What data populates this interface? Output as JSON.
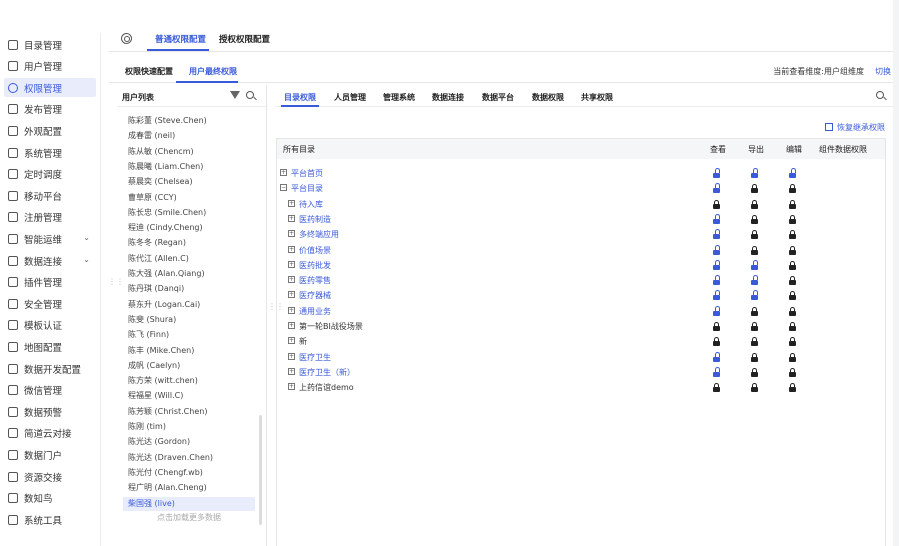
{
  "sidebar": {
    "items": [
      {
        "label": "目录管理",
        "icon": "list-icon"
      },
      {
        "label": "用户管理",
        "icon": "user-icon"
      },
      {
        "label": "权限管理",
        "icon": "shield-icon",
        "active": true
      },
      {
        "label": "发布管理",
        "icon": "publish-icon"
      },
      {
        "label": "外观配置",
        "icon": "palette-icon"
      },
      {
        "label": "系统管理",
        "icon": "gear-icon"
      },
      {
        "label": "定时调度",
        "icon": "clock-icon"
      },
      {
        "label": "移动平台",
        "icon": "mobile-icon"
      },
      {
        "label": "注册管理",
        "icon": "register-icon"
      },
      {
        "label": "智能运维",
        "icon": "ops-icon",
        "chevron": true
      },
      {
        "label": "数据连接",
        "icon": "link-icon",
        "chevron": true
      },
      {
        "label": "插件管理",
        "icon": "plugin-icon"
      },
      {
        "label": "安全管理",
        "icon": "security-icon"
      },
      {
        "label": "模板认证",
        "icon": "template-icon"
      },
      {
        "label": "地图配置",
        "icon": "map-icon"
      },
      {
        "label": "数据开发配置",
        "icon": "dev-icon"
      },
      {
        "label": "微信管理",
        "icon": "wechat-icon"
      },
      {
        "label": "数据预警",
        "icon": "alert-icon"
      },
      {
        "label": "简道云对接",
        "icon": "cloud-icon"
      },
      {
        "label": "数据门户",
        "icon": "portal-icon"
      },
      {
        "label": "资源交接",
        "icon": "handover-icon"
      },
      {
        "label": "数知鸟",
        "icon": "bird-icon"
      },
      {
        "label": "系统工具",
        "icon": "tools-icon"
      }
    ]
  },
  "top_tabs": [
    {
      "label": "普通权限配置",
      "active": true
    },
    {
      "label": "授权权限配置",
      "active": false
    }
  ],
  "sub_tabs": [
    {
      "label": "权限快速配置",
      "active": false
    },
    {
      "label": "用户最终权限",
      "active": true
    }
  ],
  "dimension_text": "当前查看维度:用户组维度",
  "switch_label": "切换",
  "user_list": {
    "title": "用户列表",
    "users": [
      "陈彩董 (Steve.Chen)",
      "成春雷 (neil)",
      "陈从敏 (Chencm)",
      "陈晨曦 (Liam.Chen)",
      "蔡晨奕 (Chelsea)",
      "曹草原 (CCY)",
      "陈长忠 (Smile.Chen)",
      "程迪 (Cindy.Cheng)",
      "陈冬冬 (Regan)",
      "陈代江 (Allen.C)",
      "陈大强 (Alan.Qiang)",
      "陈丹琪 (Danqi)",
      "蔡东升 (Logan.Cai)",
      "陈斐 (Shura)",
      "陈飞 (Finn)",
      "陈丰 (Mike.Chen)",
      "成帆 (Caelyn)",
      "陈方荣 (witt.chen)",
      "程福星 (Will.C)",
      "陈芳颖 (Christ.Chen)",
      "陈刚 (tim)",
      "陈光达 (Gordon)",
      "陈光达 (Draven.Chen)",
      "陈光付 (Chengf.wb)",
      "程广明 (Alan.Cheng)",
      "柴国强 (live)"
    ],
    "selected_index": 25,
    "load_more": "点击加载更多数据"
  },
  "perm_tabs": [
    "目录权限",
    "人员管理",
    "管理系统",
    "数据连接",
    "数据平台",
    "数据权限",
    "共享权限"
  ],
  "restore_label": "恢复继承权限",
  "table": {
    "headers": {
      "dir": "所有目录",
      "view": "查看",
      "export": "导出",
      "edit": "编辑",
      "component": "组件数据权限"
    },
    "rows": [
      {
        "label": "平台首页",
        "expander": "+",
        "indent": 0,
        "link": true,
        "view": "open",
        "export": "open",
        "edit": "open"
      },
      {
        "label": "平台目录",
        "expander": "−",
        "indent": 0,
        "link": true,
        "view": "open",
        "export": "locked",
        "edit": "locked"
      },
      {
        "label": "待入库",
        "expander": "+",
        "indent": 1,
        "link": true,
        "view": "locked",
        "export": "locked",
        "edit": "locked"
      },
      {
        "label": "医药制造",
        "expander": "+",
        "indent": 1,
        "link": true,
        "view": "open",
        "export": "locked",
        "edit": "locked"
      },
      {
        "label": "多终端应用",
        "expander": "+",
        "indent": 1,
        "link": true,
        "view": "open",
        "export": "locked",
        "edit": "locked"
      },
      {
        "label": "价值场景",
        "expander": "+",
        "indent": 1,
        "link": true,
        "view": "open",
        "export": "locked",
        "edit": "locked"
      },
      {
        "label": "医药批发",
        "expander": "+",
        "indent": 1,
        "link": true,
        "view": "open",
        "export": "open",
        "edit": "locked"
      },
      {
        "label": "医药零售",
        "expander": "+",
        "indent": 1,
        "link": true,
        "view": "open",
        "export": "open",
        "edit": "locked"
      },
      {
        "label": "医疗器械",
        "expander": "+",
        "indent": 1,
        "link": true,
        "view": "open",
        "export": "open",
        "edit": "locked"
      },
      {
        "label": "通用业务",
        "expander": "+",
        "indent": 1,
        "link": true,
        "view": "open",
        "export": "locked",
        "edit": "locked"
      },
      {
        "label": "第一轮BI战役场景",
        "expander": "+",
        "indent": 1,
        "link": false,
        "view": "locked",
        "export": "locked",
        "edit": "locked"
      },
      {
        "label": "新",
        "expander": "+",
        "indent": 1,
        "link": false,
        "view": "locked",
        "export": "locked",
        "edit": "locked"
      },
      {
        "label": "医疗卫生",
        "expander": "+",
        "indent": 1,
        "link": true,
        "view": "open",
        "export": "locked",
        "edit": "locked"
      },
      {
        "label": "医疗卫生（新）",
        "expander": "+",
        "indent": 1,
        "link": true,
        "view": "open",
        "export": "locked",
        "edit": "locked"
      },
      {
        "label": "上药信谊demo",
        "expander": "+",
        "indent": 1,
        "link": false,
        "view": "locked",
        "export": "locked",
        "edit": "locked"
      }
    ]
  },
  "colors": {
    "accent": "#3a5bd9",
    "selected_bg": "#e8ecfb"
  }
}
